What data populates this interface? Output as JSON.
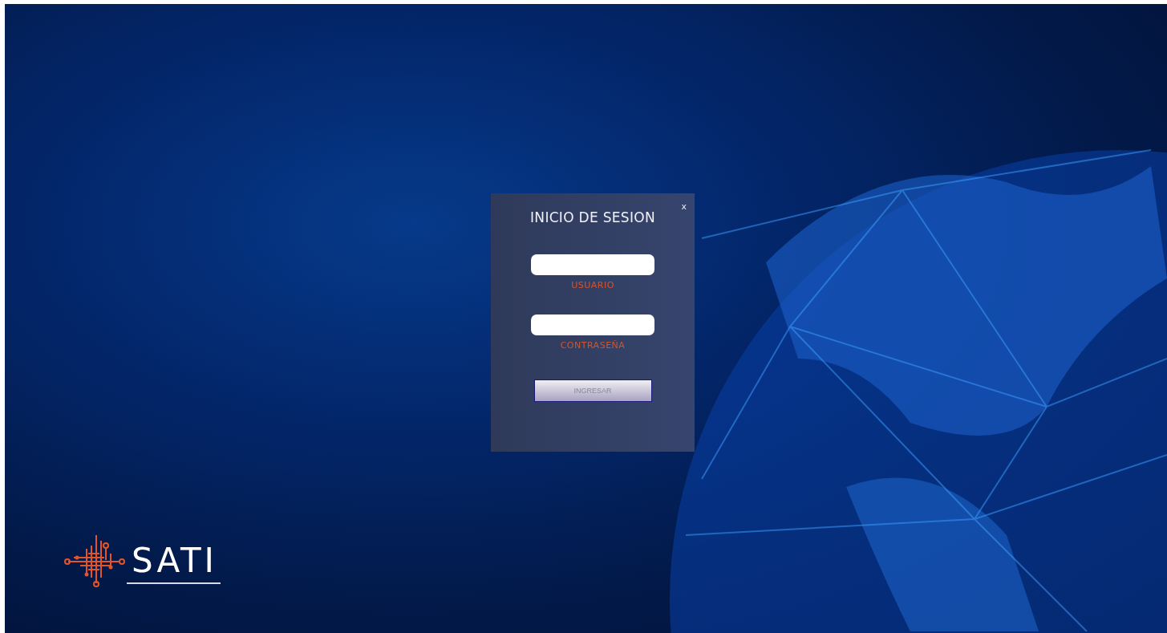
{
  "login_dialog": {
    "title": "INICIO DE SESION",
    "close": "x",
    "fields": [
      {
        "label": "USUARIO"
      },
      {
        "label": "CONTRASEÑA"
      }
    ],
    "button": "INGRESAR"
  },
  "logo": {
    "text": "SATI"
  }
}
